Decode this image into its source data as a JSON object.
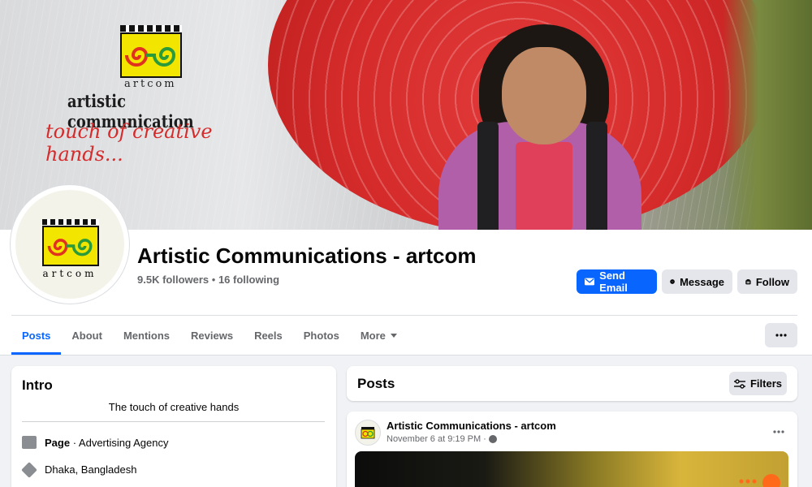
{
  "cover": {
    "brand_sub": "artcom",
    "brand_title": "artistic communication",
    "brand_tagline": "touch of creative hands..."
  },
  "avatar": {
    "text": "artcom"
  },
  "page": {
    "name": "Artistic Communications - artcom",
    "followers": "9.5K followers",
    "following": "16 following"
  },
  "actions": {
    "send_email": "Send Email",
    "message": "Message",
    "follow": "Follow"
  },
  "tabs": [
    {
      "label": "Posts"
    },
    {
      "label": "About"
    },
    {
      "label": "Mentions"
    },
    {
      "label": "Reviews"
    },
    {
      "label": "Reels"
    },
    {
      "label": "Photos"
    },
    {
      "label": "More"
    }
  ],
  "intro": {
    "title": "Intro",
    "bio": "The touch of creative hands",
    "category_prefix": "Page",
    "category": "Advertising Agency",
    "location": "Dhaka, Bangladesh"
  },
  "posts": {
    "title": "Posts",
    "filters": "Filters"
  },
  "post": {
    "author": "Artistic Communications - artcom",
    "time": "November 6 at 9:19 PM"
  },
  "colors": {
    "accent": "#0866ff",
    "secondary_button": "#e4e6eb",
    "background": "#f0f2f5"
  }
}
